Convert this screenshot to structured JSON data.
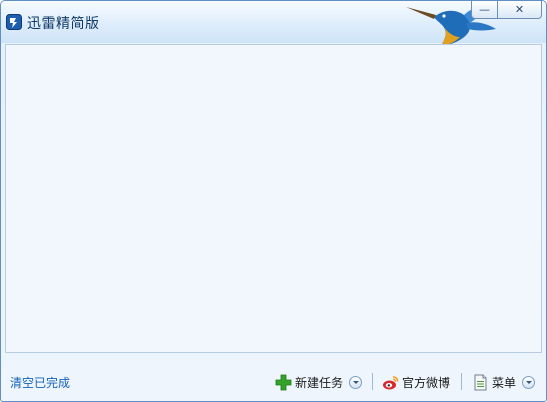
{
  "window": {
    "title": "迅雷精简版",
    "minimize_label": "—",
    "close_label": "✕"
  },
  "statusbar": {
    "clear_completed": "清空已完成",
    "new_task": "新建任务",
    "weibo": "官方微博",
    "menu": "菜单"
  },
  "icons": {
    "app": "thunder-logo-icon",
    "mascot": "hummingbird-icon",
    "new_task": "plus-icon",
    "weibo": "weibo-icon",
    "menu": "document-icon",
    "dropdown": "chevron-down-icon"
  },
  "colors": {
    "accent": "#1464b8",
    "frame": "#5f8fc4",
    "content_bg": "#f1f7fd",
    "plus_green": "#35a32a",
    "weibo_red": "#d8272d"
  }
}
